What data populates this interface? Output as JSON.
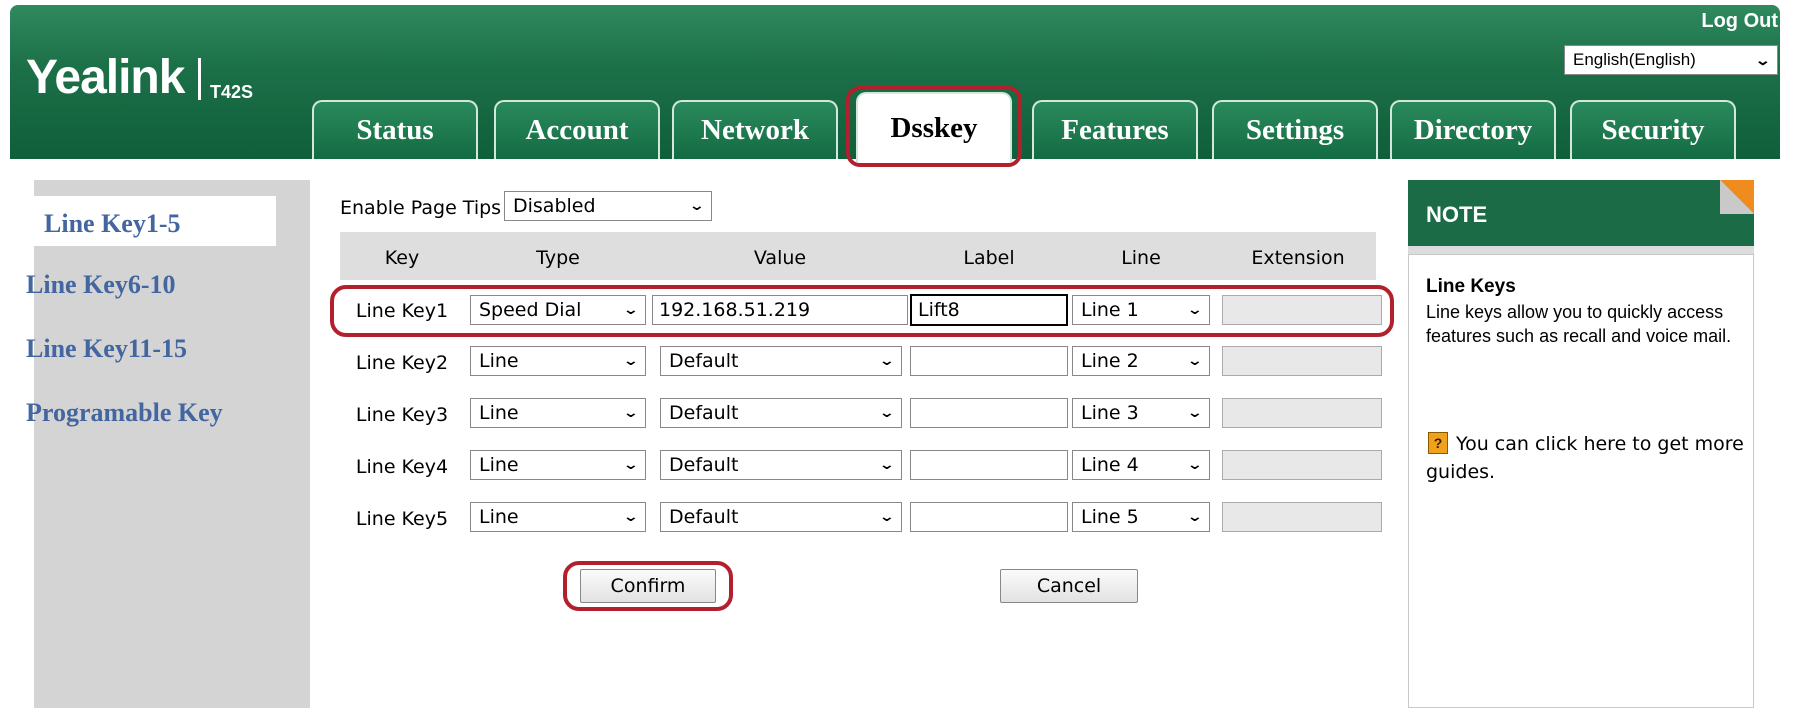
{
  "header": {
    "brand": "Yealink",
    "model": "T42S",
    "logout": "Log Out",
    "language": "English(English)"
  },
  "tabs": [
    {
      "label": "Status"
    },
    {
      "label": "Account"
    },
    {
      "label": "Network"
    },
    {
      "label": "Dsskey",
      "active": true
    },
    {
      "label": "Features"
    },
    {
      "label": "Settings"
    },
    {
      "label": "Directory"
    },
    {
      "label": "Security"
    }
  ],
  "sidebar": {
    "items": [
      {
        "label": "Line Key1-5",
        "active": true
      },
      {
        "label": "Line Key6-10"
      },
      {
        "label": "Line Key11-15"
      },
      {
        "label": "Programable Key"
      }
    ]
  },
  "main": {
    "page_tips_label": "Enable Page Tips",
    "page_tips_value": "Disabled",
    "columns": [
      "Key",
      "Type",
      "Value",
      "Label",
      "Line",
      "Extension"
    ],
    "rows": [
      {
        "key": "Line Key1",
        "type": "Speed Dial",
        "value": "192.168.51.219",
        "label": "Lift8",
        "line": "Line 1",
        "extension": ""
      },
      {
        "key": "Line Key2",
        "type": "Line",
        "value": "Default",
        "label": "",
        "line": "Line 2",
        "extension": ""
      },
      {
        "key": "Line Key3",
        "type": "Line",
        "value": "Default",
        "label": "",
        "line": "Line 3",
        "extension": ""
      },
      {
        "key": "Line Key4",
        "type": "Line",
        "value": "Default",
        "label": "",
        "line": "Line 4",
        "extension": ""
      },
      {
        "key": "Line Key5",
        "type": "Line",
        "value": "Default",
        "label": "",
        "line": "Line 5",
        "extension": ""
      }
    ],
    "confirm": "Confirm",
    "cancel": "Cancel"
  },
  "note": {
    "heading": "NOTE",
    "title": "Line Keys",
    "text": "Line keys allow you to quickly access features such as recall and voice mail.",
    "guide_icon": "?",
    "guide_text": "You can click here to get more guides."
  },
  "colors": {
    "header_green": "#1c7048",
    "highlight_red": "#b3202d",
    "nav_blue": "#4366a0",
    "note_corner": "#f08b1d"
  }
}
